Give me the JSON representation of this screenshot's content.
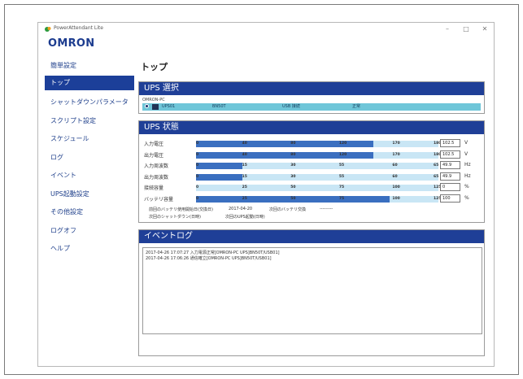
{
  "window": {
    "app_title": "PowerAttendant Lite",
    "minimize": "–",
    "maximize": "□",
    "close": "✕",
    "logo": "OMRON"
  },
  "sidebar": {
    "items": [
      {
        "label": "簡単設定",
        "active": false
      },
      {
        "label": "トップ",
        "active": true
      },
      {
        "label": "シャットダウンパラメータ",
        "active": false
      },
      {
        "label": "スクリプト設定",
        "active": false
      },
      {
        "label": "スケジュール",
        "active": false
      },
      {
        "label": "ログ",
        "active": false
      },
      {
        "label": "イベント",
        "active": false
      },
      {
        "label": "UPS起動設定",
        "active": false
      },
      {
        "label": "その他設定",
        "active": false
      },
      {
        "label": "ログオフ",
        "active": false
      },
      {
        "label": "ヘルプ",
        "active": false
      }
    ]
  },
  "page_title": "トップ",
  "ups_select": {
    "header": "UPS 選択",
    "host": "OMRON-PC",
    "row": {
      "c1": "UPS01",
      "c2": "BN50T",
      "c3": "USB 接続",
      "c4": "正常"
    }
  },
  "ups_status": {
    "header": "UPS 状態",
    "meters": [
      {
        "label": "入力電圧",
        "fill": 0.73,
        "ticks": [
          "0",
          "40",
          "80",
          "120",
          "170",
          "180"
        ],
        "value": "102.5",
        "unit": "V"
      },
      {
        "label": "出力電圧",
        "fill": 0.73,
        "ticks": [
          "0",
          "40",
          "80",
          "120",
          "170",
          "180"
        ],
        "value": "102.5",
        "unit": "V"
      },
      {
        "label": "入力周波数",
        "fill": 0.19,
        "ticks": [
          "0",
          "15",
          "30",
          "55",
          "60",
          "65"
        ],
        "value": "49.9",
        "unit": "Hz"
      },
      {
        "label": "出力周波数",
        "fill": 0.19,
        "ticks": [
          "0",
          "15",
          "30",
          "55",
          "60",
          "65"
        ],
        "value": "49.9",
        "unit": "Hz"
      },
      {
        "label": "接続容量",
        "fill": 0.0,
        "ticks": [
          "0",
          "25",
          "50",
          "75",
          "100",
          "125"
        ],
        "value": "0",
        "unit": "%"
      },
      {
        "label": "バッテリ容量",
        "fill": 0.8,
        "ticks": [
          "0",
          "25",
          "50",
          "75",
          "100",
          "125"
        ],
        "value": "100",
        "unit": "%"
      }
    ],
    "info": {
      "battery_date_label": "前回のバッテリ使用開始日(交換日)",
      "battery_date": "2017-04-20",
      "next_replace_label": "次回のバッテリ交換",
      "next_replace": "---------",
      "next_shutdown_label": "次回のシャットダウン(日時)",
      "next_startup_label": "次回のUPS起動(日時)"
    }
  },
  "event_log": {
    "header": "イベントログ",
    "lines": [
      "2017-04-26 17:07:27 入力電源正常[OMRON-PC UPS]BN50T/USB01]",
      "2017-04-26 17:06:26 通信確立[OMRON-PC UPS]BN50T/USB01]"
    ]
  },
  "colors": {
    "brand": "#1c3c8f",
    "header": "#1f3f97",
    "bar": "#3a6fc0",
    "track": "#c9e6f5",
    "select_row": "#6fc6d9"
  }
}
